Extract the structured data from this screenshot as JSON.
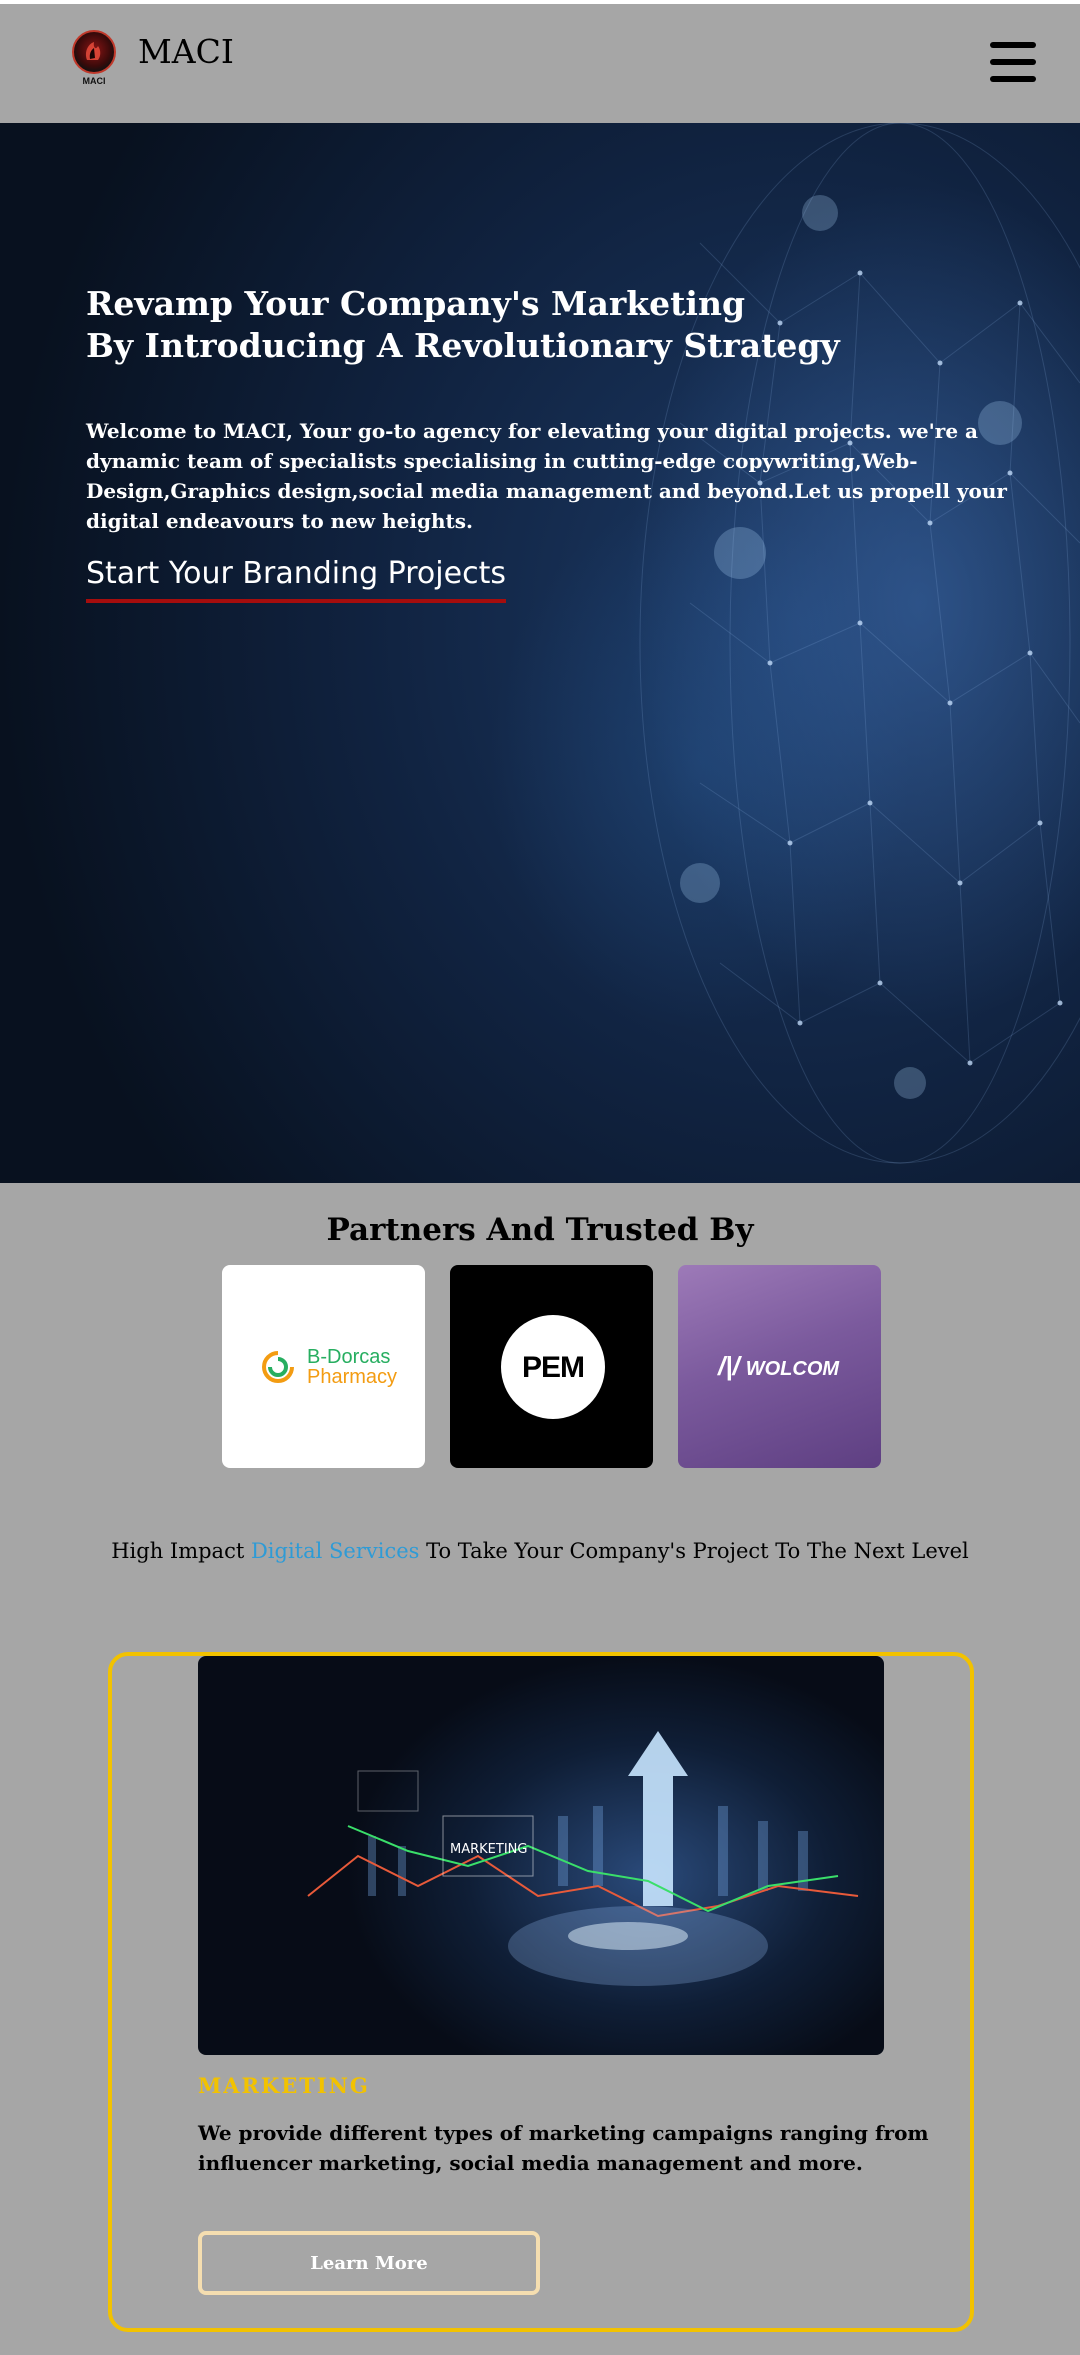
{
  "header": {
    "logo_text": "MACI",
    "brand": "MACI"
  },
  "hero": {
    "title_line1": "Revamp Your Company's Marketing",
    "title_line2": "By Introducing A Revolutionary Strategy",
    "description": "Welcome to MACI, Your go-to agency for elevating your digital projects. we're a dynamic team of specialists specialising in cutting-edge copywriting,Web-Design,Graphics design,social media management and beyond.Let us propell your digital endeavours to new heights.",
    "cta": "Start Your Branding Projects"
  },
  "partners": {
    "title": "Partners And Trusted By",
    "items": [
      {
        "name_line1": "B-Dorcas",
        "name_line2": "Pharmacy"
      },
      {
        "name": "PEM"
      },
      {
        "name": "WOLCOM"
      }
    ]
  },
  "services": {
    "intro_before": "High Impact ",
    "intro_highlight": "Digital Services",
    "intro_after": " To Take Your Company's Project To The Next Level"
  },
  "card": {
    "image_caption": "MARKETING",
    "category": "MARKETING",
    "description": "We provide different types of marketing campaigns ranging from influencer marketing, social media management and more.",
    "button": "Learn More"
  },
  "colors": {
    "page_bg": "#a6a6a6",
    "accent_yellow": "#f2c200",
    "accent_red": "#a50d0d",
    "link_blue": "#2e9bd6"
  }
}
